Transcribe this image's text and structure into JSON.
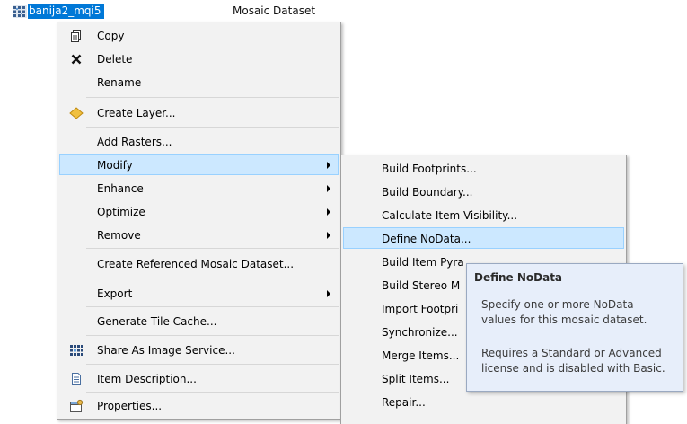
{
  "dataset": {
    "name": "banija2_mqi5",
    "type": "Mosaic Dataset"
  },
  "main_menu": {
    "copy": "Copy",
    "delete": "Delete",
    "rename": "Rename",
    "create_layer": "Create Layer...",
    "add_rasters": "Add Rasters...",
    "modify": "Modify",
    "enhance": "Enhance",
    "optimize": "Optimize",
    "remove": "Remove",
    "create_referenced": "Create Referenced Mosaic Dataset...",
    "export": "Export",
    "generate_tile_cache": "Generate Tile Cache...",
    "share_image_service": "Share As Image Service...",
    "item_description": "Item Description...",
    "properties": "Properties..."
  },
  "sub_menu": {
    "build_footprints": "Build Footprints...",
    "build_boundary": "Build Boundary...",
    "calculate_item_visibility": "Calculate Item Visibility...",
    "define_nodata": "Define NoData...",
    "build_item_pyramids": "Build Item Pyra",
    "build_stereo": "Build Stereo M",
    "import_footprints": "Import Footpri",
    "synchronize": "Synchronize...",
    "merge_items": "Merge Items...",
    "split_items": "Split Items...",
    "repair": "Repair..."
  },
  "tooltip": {
    "title": "Define NoData",
    "line1": "Specify one or more NoData",
    "line2": "values for this mosaic dataset.",
    "line3": "Requires a Standard or Advanced",
    "line4": "license and is disabled with Basic."
  },
  "colors": {
    "selection": "#0078d7",
    "hover_fill": "#cce8ff",
    "hover_border": "#99d1ff",
    "menu_bg": "#f2f2f2",
    "tooltip_bg": "#e7eefa"
  }
}
